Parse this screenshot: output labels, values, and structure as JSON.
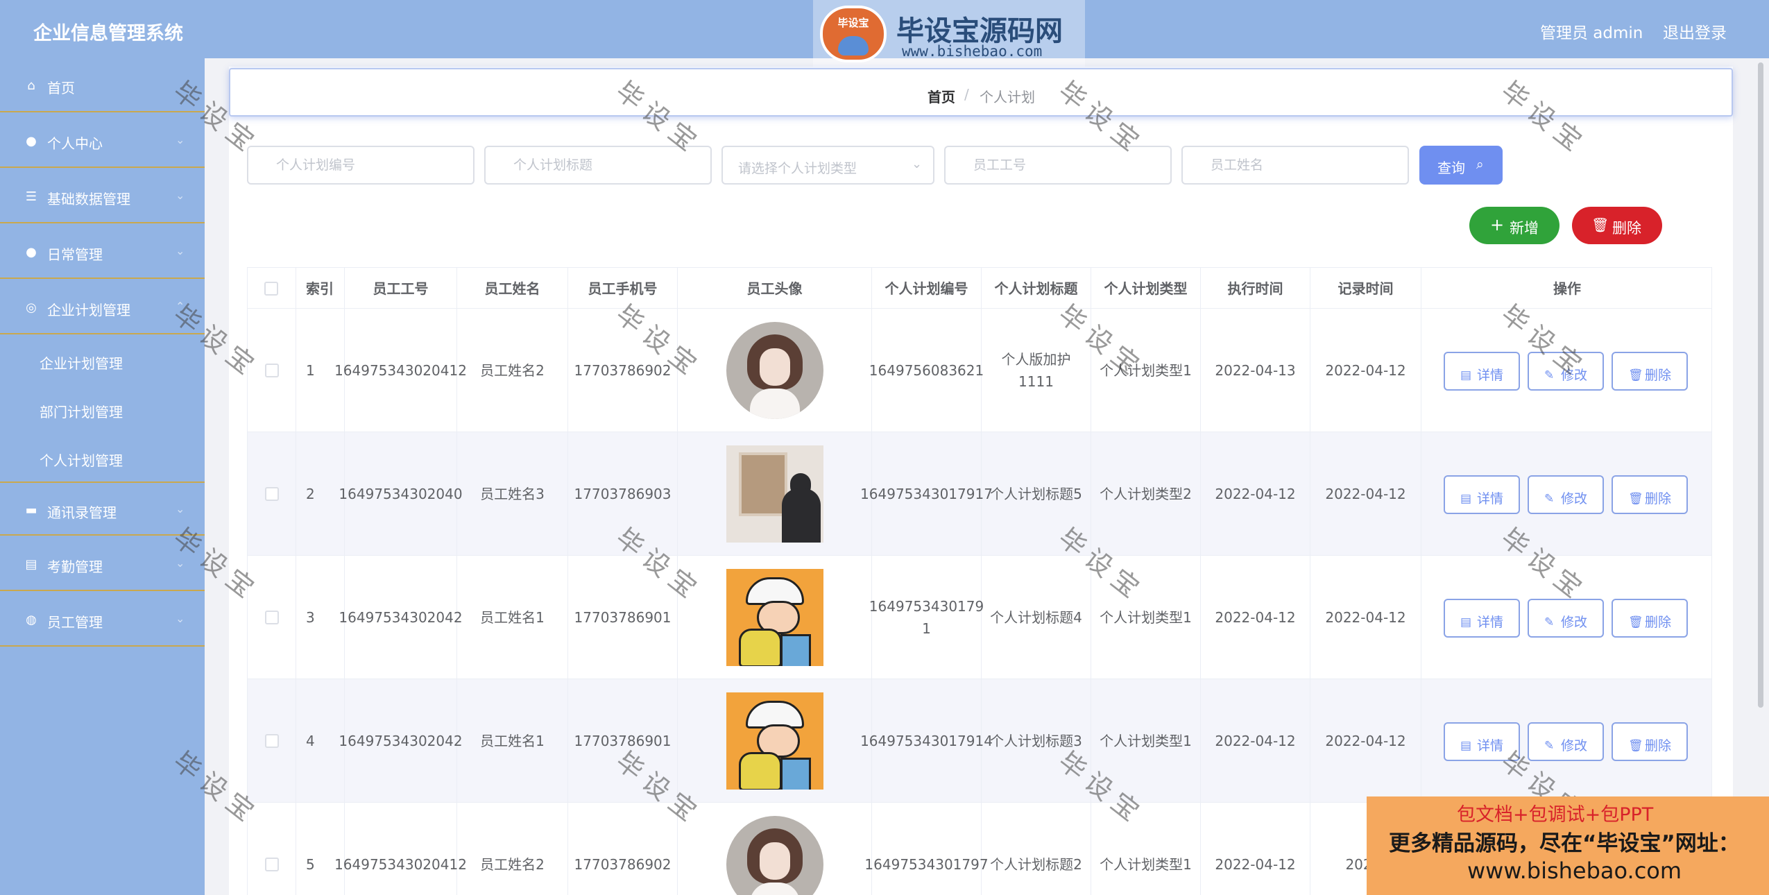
{
  "header": {
    "app_title": "企业信息管理系统",
    "user_label": "管理员 admin",
    "logout_label": "退出登录",
    "brand_badge": "毕设宝",
    "brand_name": "毕设宝源码网",
    "brand_url": "www.bishebao.com"
  },
  "sidebar": {
    "items": [
      {
        "label": "首页",
        "icon": "home-icon"
      },
      {
        "label": "个人中心",
        "icon": "user-icon"
      },
      {
        "label": "基础数据管理",
        "icon": "sliders-icon"
      },
      {
        "label": "日常管理",
        "icon": "bulb-icon"
      },
      {
        "label": "企业计划管理",
        "icon": "compass-icon"
      },
      {
        "label": "通讯录管理",
        "icon": "briefcase-icon"
      },
      {
        "label": "考勤管理",
        "icon": "clipboard-icon"
      },
      {
        "label": "员工管理",
        "icon": "globe-icon"
      }
    ],
    "sub_items": [
      "企业计划管理",
      "部门计划管理",
      "个人计划管理"
    ]
  },
  "breadcrumb": {
    "home": "首页",
    "separator": "/",
    "current": "个人计划"
  },
  "search": {
    "plan_no_placeholder": "个人计划编号",
    "plan_title_placeholder": "个人计划标题",
    "plan_type_placeholder": "请选择个人计划类型",
    "emp_no_placeholder": "员工工号",
    "emp_name_placeholder": "员工姓名",
    "query_label": "查询"
  },
  "actions": {
    "add_label": "新增",
    "delete_label": "删除"
  },
  "table": {
    "columns": [
      "索引",
      "员工工号",
      "员工姓名",
      "员工手机号",
      "员工头像",
      "个人计划编号",
      "个人计划标题",
      "个人计划类型",
      "执行时间",
      "记录时间",
      "操作"
    ],
    "row_actions": {
      "detail": "详情",
      "edit": "修改",
      "delete": "删除"
    },
    "rows": [
      {
        "index": "1",
        "emp_no": "164975343020412",
        "emp_name": "员工姓名2",
        "phone": "17703786902",
        "avatar": "avatar-girl",
        "plan_no": "1649756083621",
        "plan_title": "个人版加护1111",
        "plan_type": "个人计划类型1",
        "exec_time": "2022-04-13",
        "record_time": "2022-04-12"
      },
      {
        "index": "2",
        "emp_no": "16497534302040",
        "emp_name": "员工姓名3",
        "phone": "17703786903",
        "avatar": "avatar-room",
        "plan_no": "164975343017917",
        "plan_title": "个人计划标题5",
        "plan_type": "个人计划类型2",
        "exec_time": "2022-04-12",
        "record_time": "2022-04-12"
      },
      {
        "index": "3",
        "emp_no": "16497534302042",
        "emp_name": "员工姓名1",
        "phone": "17703786901",
        "avatar": "avatar-kid",
        "plan_no": "1649753430179 1",
        "plan_title": "个人计划标题4",
        "plan_type": "个人计划类型1",
        "exec_time": "2022-04-12",
        "record_time": "2022-04-12"
      },
      {
        "index": "4",
        "emp_no": "16497534302042",
        "emp_name": "员工姓名1",
        "phone": "17703786901",
        "avatar": "avatar-kid",
        "plan_no": "164975343017914",
        "plan_title": "个人计划标题3",
        "plan_type": "个人计划类型1",
        "exec_time": "2022-04-12",
        "record_time": "2022-04-12"
      },
      {
        "index": "5",
        "emp_no": "164975343020412",
        "emp_name": "员工姓名2",
        "phone": "17703786902",
        "avatar": "avatar-girl",
        "plan_no": "16497534301797",
        "plan_title": "个人计划标题2",
        "plan_type": "个人计划类型1",
        "exec_time": "2022-04-12",
        "record_time": "2022-"
      }
    ]
  },
  "watermark": "毕设宝",
  "promo": {
    "line1": "包文档+包调试+包PPT",
    "line2": "更多精品源码，尽在“毕设宝”网址：",
    "line3": "www.bishebao.com"
  }
}
